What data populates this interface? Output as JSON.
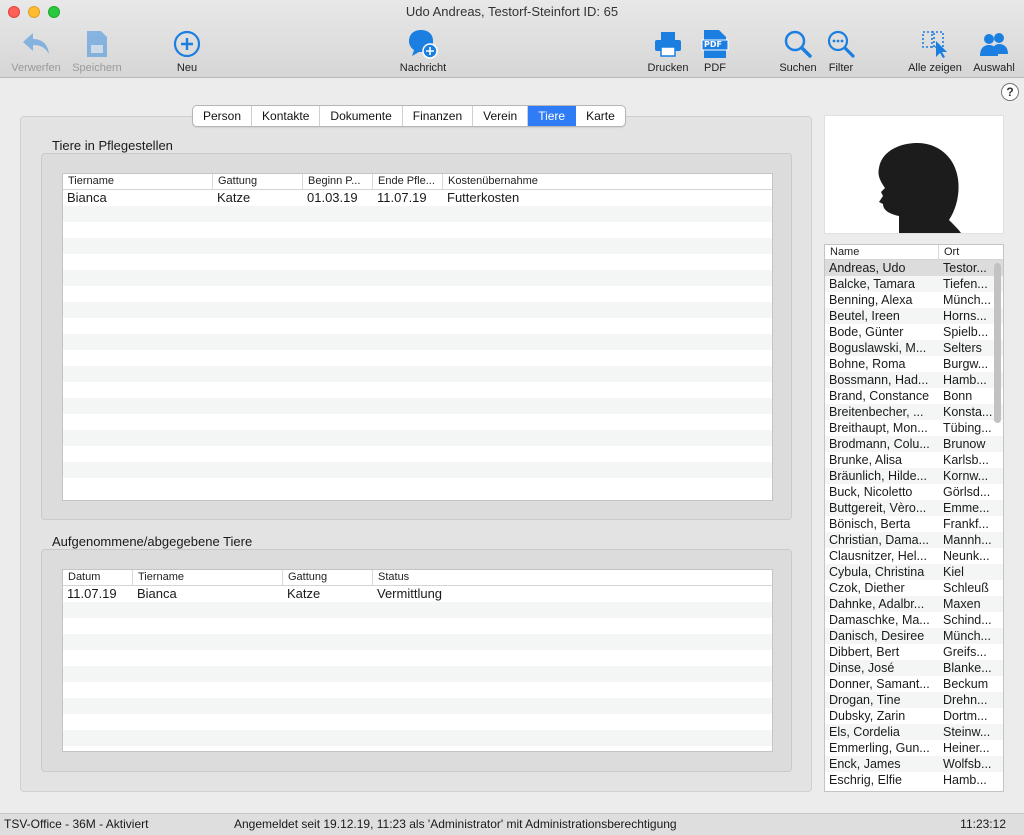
{
  "window": {
    "title": "Udo Andreas, Testorf-Steinfort ID: 65"
  },
  "toolbar": {
    "discard": "Verwerfen",
    "save": "Speichern",
    "new": "Neu",
    "message": "Nachricht",
    "print": "Drucken",
    "pdf": "PDF",
    "pdf_badge": "PDF",
    "search": "Suchen",
    "filter": "Filter",
    "show_all": "Alle zeigen",
    "selection": "Auswahl"
  },
  "help": "?",
  "tabs": [
    {
      "label": "Person"
    },
    {
      "label": "Kontakte"
    },
    {
      "label": "Dokumente"
    },
    {
      "label": "Finanzen"
    },
    {
      "label": "Verein"
    },
    {
      "label": "Tiere",
      "active": true
    },
    {
      "label": "Karte"
    }
  ],
  "foster": {
    "title": "Tiere in Pflegestellen",
    "columns": [
      "Tiername",
      "Gattung",
      "Beginn P...",
      "Ende Pfle...",
      "Kostenübernahme"
    ],
    "rows": [
      [
        "Bianca",
        "Katze",
        "01.03.19",
        "11.07.19",
        "Futterkosten"
      ]
    ]
  },
  "taken": {
    "title": "Aufgenommene/abgegebene Tiere",
    "columns": [
      "Datum",
      "Tiername",
      "Gattung",
      "Status"
    ],
    "rows": [
      [
        "11.07.19",
        "Bianca",
        "Katze",
        "Vermittlung"
      ]
    ]
  },
  "people": {
    "columns": [
      "Name",
      "Ort"
    ],
    "rows": [
      [
        "Andreas, Udo",
        "Testor..."
      ],
      [
        "Balcke, Tamara",
        "Tiefen..."
      ],
      [
        "Benning, Alexa",
        "Münch..."
      ],
      [
        "Beutel, Ireen",
        "Horns..."
      ],
      [
        "Bode, Günter",
        "Spielb..."
      ],
      [
        "Boguslawski, M...",
        "Selters"
      ],
      [
        "Bohne, Roma",
        "Burgw..."
      ],
      [
        "Bossmann, Had...",
        "Hamb..."
      ],
      [
        "Brand, Constance",
        "Bonn"
      ],
      [
        "Breitenbecher, ...",
        "Konsta..."
      ],
      [
        "Breithaupt, Mon...",
        "Tübing..."
      ],
      [
        "Brodmann, Colu...",
        "Brunow"
      ],
      [
        "Brunke, Alisa",
        "Karlsb..."
      ],
      [
        "Bräunlich, Hilde...",
        "Kornw..."
      ],
      [
        "Buck, Nicoletto",
        "Görlsd..."
      ],
      [
        "Buttgereit, Vèro...",
        "Emme..."
      ],
      [
        "Bönisch, Berta",
        "Frankf..."
      ],
      [
        "Christian, Dama...",
        "Mannh..."
      ],
      [
        "Clausnitzer, Hel...",
        "Neunk..."
      ],
      [
        "Cybula, Christina",
        "Kiel"
      ],
      [
        "Czok, Diether",
        "Schleuß"
      ],
      [
        "Dahnke, Adalbr...",
        "Maxen"
      ],
      [
        "Damaschke, Ma...",
        "Schind..."
      ],
      [
        "Danisch, Desiree",
        "Münch..."
      ],
      [
        "Dibbert, Bert",
        "Greifs..."
      ],
      [
        "Dinse, José",
        "Blanke..."
      ],
      [
        "Donner, Samant...",
        "Beckum"
      ],
      [
        "Drogan, Tine",
        "Drehn..."
      ],
      [
        "Dubsky, Zarin",
        "Dortm..."
      ],
      [
        "Els, Cordelia",
        "Steinw..."
      ],
      [
        "Emmerling, Gun...",
        "Heiner..."
      ],
      [
        "Enck, James",
        "Wolfsb..."
      ],
      [
        "Eschrig, Elfie",
        "Hamb..."
      ]
    ]
  },
  "status": {
    "left": "TSV-Office - 36M - Aktiviert",
    "middle": "Angemeldet seit 19.12.19, 11:23 als 'Administrator' mit Administrationsberechtigung",
    "time": "11:23:12"
  },
  "colors": {
    "accent": "#2f7cf6",
    "icon_blue": "#1a7fe0"
  }
}
